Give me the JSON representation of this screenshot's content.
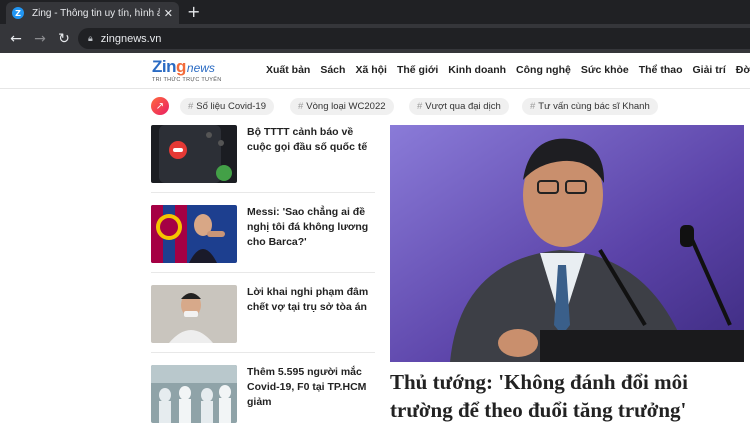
{
  "browser": {
    "tab_title": "Zing - Thông tin uy tín, hình ảnh",
    "favicon_letter": "Z",
    "url": "zingnews.vn"
  },
  "site": {
    "logo_text": "Zing",
    "logo_suffix": "news",
    "tagline": "TRI THỨC TRỰC TUYẾN",
    "menu": [
      "Xuất bản",
      "Sách",
      "Xã hội",
      "Thế giới",
      "Kinh doanh",
      "Công nghệ",
      "Sức khỏe",
      "Thể thao",
      "Giải trí",
      "Đời"
    ]
  },
  "trending": [
    "Số liệu Covid-19",
    "Vòng loại WC2022",
    "Vượt qua đại dịch",
    "Tư vấn cùng bác sĩ Khanh"
  ],
  "articles": [
    {
      "title": "Bộ TTTT cảnh báo về cuộc gọi đầu số quốc tế"
    },
    {
      "title": "Messi: 'Sao chẳng ai đề nghị tôi đá không lương cho Barca?'"
    },
    {
      "title": "Lời khai nghi phạm đâm chết vợ tại trụ sở tòa án"
    },
    {
      "title": "Thêm 5.595 người mắc Covid-19, F0 tại TP.HCM giảm"
    }
  ],
  "feature": {
    "title": "Thủ tướng: 'Không đánh đổi môi trường để theo đuổi tăng trưởng'"
  },
  "colors": {
    "accent_blue": "#2a6bc3",
    "accent_orange": "#f26b3a"
  }
}
